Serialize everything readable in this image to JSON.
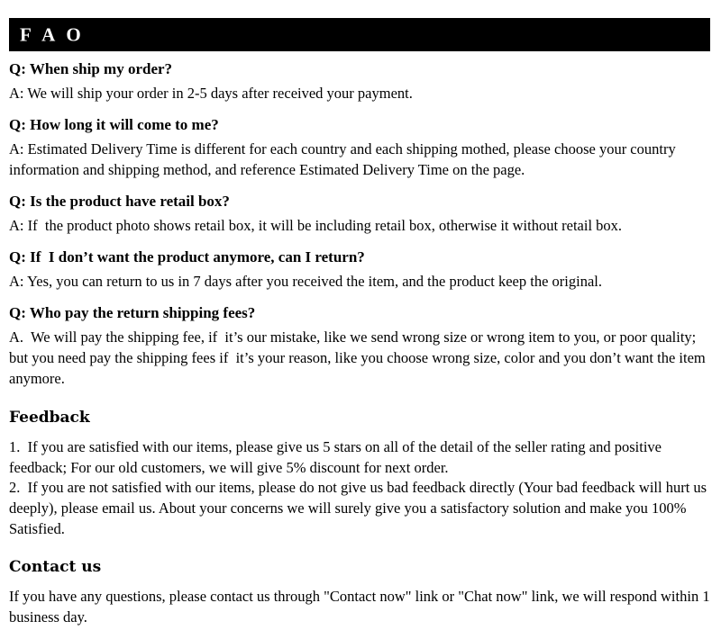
{
  "banner": {
    "title": "F A O",
    "background_color": "#000000",
    "text_color": "#ffffff"
  },
  "faq": {
    "items": [
      {
        "question": "Q: When ship my order?",
        "answer": "A: We will ship your order in 2-5 days after received your payment."
      },
      {
        "question": "Q: How long it will come to me?",
        "answer": "A: Estimated Delivery Time is different for each country and each shipping mothed, please choose your country information and shipping method, and reference Estimated Delivery Time on the page."
      },
      {
        "question": "Q: Is the product have retail box?",
        "answer": "A: If  the product photo shows retail box, it will be including retail box, otherwise it without retail box."
      },
      {
        "question": "Q: If  I don’t want the product anymore, can I return?",
        "answer": "A: Yes, you can return to us in 7 days after you received the item, and the product keep the original."
      },
      {
        "question": "Q: Who pay the return shipping fees?",
        "answer": "A.  We will pay the shipping fee, if  it’s our mistake, like we send wrong size or wrong item to you, or poor quality; but you need pay the shipping fees if  it’s your reason, like you choose wrong size, color and you don’t want the item anymore."
      }
    ]
  },
  "feedback": {
    "heading": "Feedback",
    "paragraphs": [
      "1.  If you are satisfied with our items, please give us 5 stars on all of the detail of the seller rating and positive feedback; For our old customers, we will give 5% discount for next order.",
      "2.  If you are not satisfied with our items, please do not give us bad feedback directly (Your bad feedback will hurt us deeply), please email us. About your concerns we will surely give you a satisfactory solution and make you 100% Satisfied."
    ]
  },
  "contact": {
    "heading": "Contact us",
    "paragraphs": [
      "If you have any questions, please contact us through \"Contact now\" link or \"Chat now\" link, we will respond within 1 business day."
    ]
  }
}
